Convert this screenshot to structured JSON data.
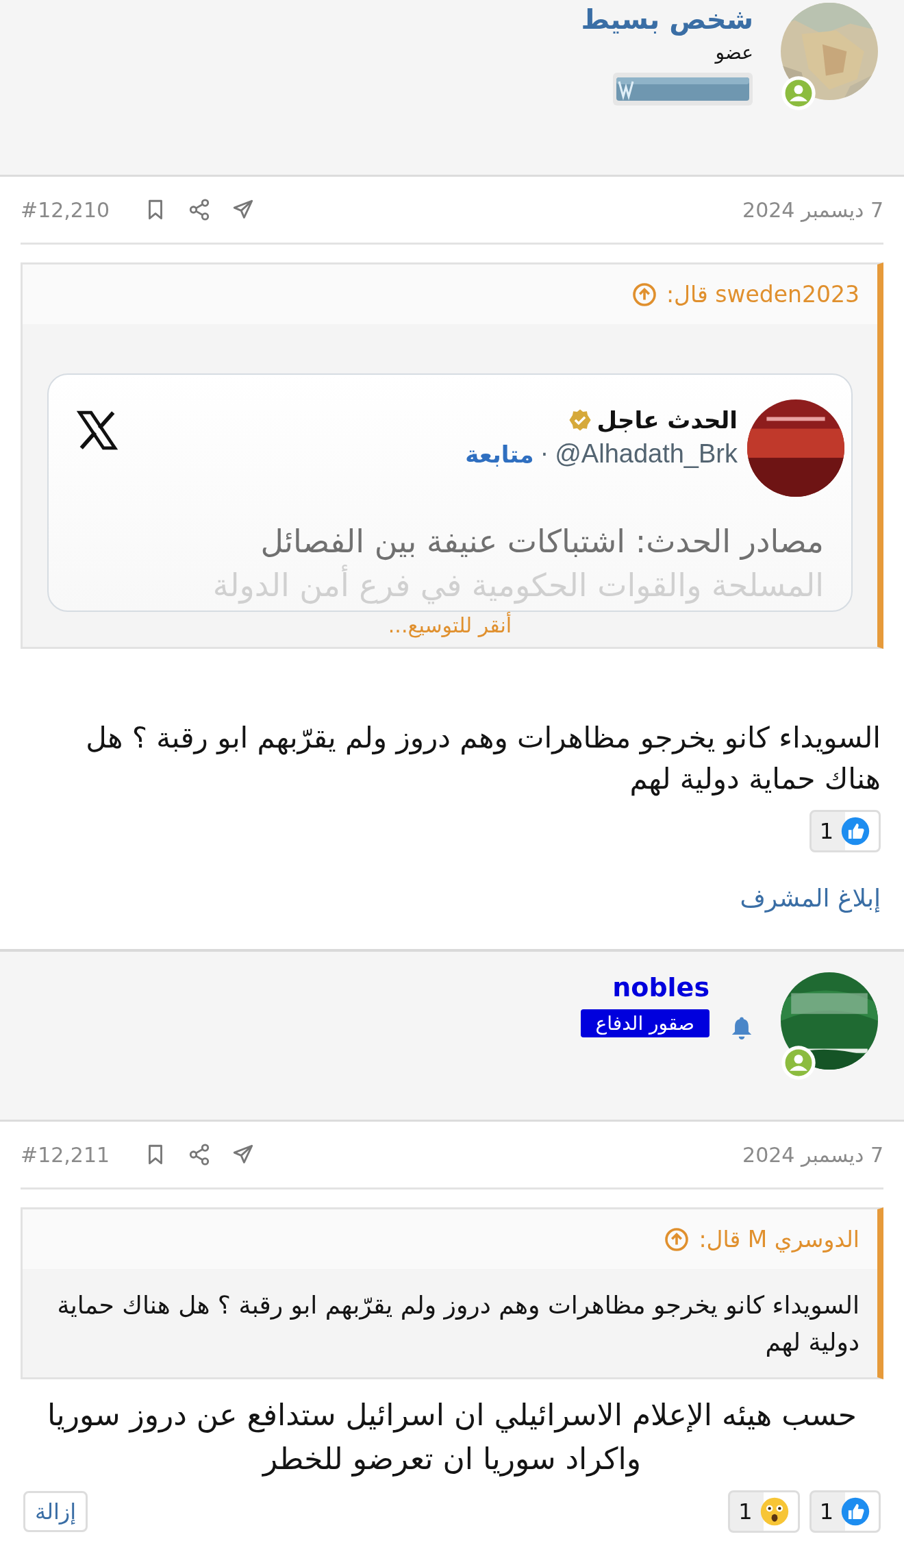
{
  "posts": [
    {
      "author": {
        "name": "شخص بسيط",
        "role": {
          "kind": "title",
          "text": "عضو"
        },
        "watching": false
      },
      "date": "7 ديسمبر 2024",
      "number": "#12,210",
      "quote": {
        "title": "sweden2023 قال:",
        "kind": "tweet",
        "tweet": {
          "account": "الحدث عاجل",
          "handle": "@Alhadath_Brk",
          "separator": "·",
          "follow": "متابعة",
          "lines": [
            "مصادر الحدث: اشتباكات عنيفة بين الفصائل",
            "المسلحة والقوات الحكومية في فرع أمن الدولة"
          ]
        },
        "expand": "أنقر للتوسيع..."
      },
      "text": "السويداء كانو يخرجو مظاهرات وهم دروز ولم يقرّبهم ابو رقبة ؟ هل هناك حماية دولية لهم",
      "reactions": [
        {
          "kind": "like",
          "count": "1"
        }
      ],
      "action": {
        "kind": "link",
        "label": "إبلاغ المشرف"
      }
    },
    {
      "author": {
        "name": "nobles",
        "role": {
          "kind": "banner",
          "text": "صقور الدفاع"
        },
        "watching": true
      },
      "date": "7 ديسمبر 2024",
      "number": "#12,211",
      "quote": {
        "title": "الدوسري M قال:",
        "kind": "text",
        "text": "السويداء كانو يخرجو مظاهرات وهم دروز ولم يقرّبهم ابو رقبة ؟ هل هناك حماية دولية لهم"
      },
      "text": "حسب هيئه الإعلام الاسرائيلي ان اسرائيل ستدافع عن دروز سوريا واكراد سوريا ان تعرضو للخطر",
      "reactions": [
        {
          "kind": "like",
          "count": "1"
        },
        {
          "kind": "wow",
          "count": "1"
        }
      ],
      "action": {
        "kind": "button",
        "label": "إزالة"
      }
    }
  ]
}
